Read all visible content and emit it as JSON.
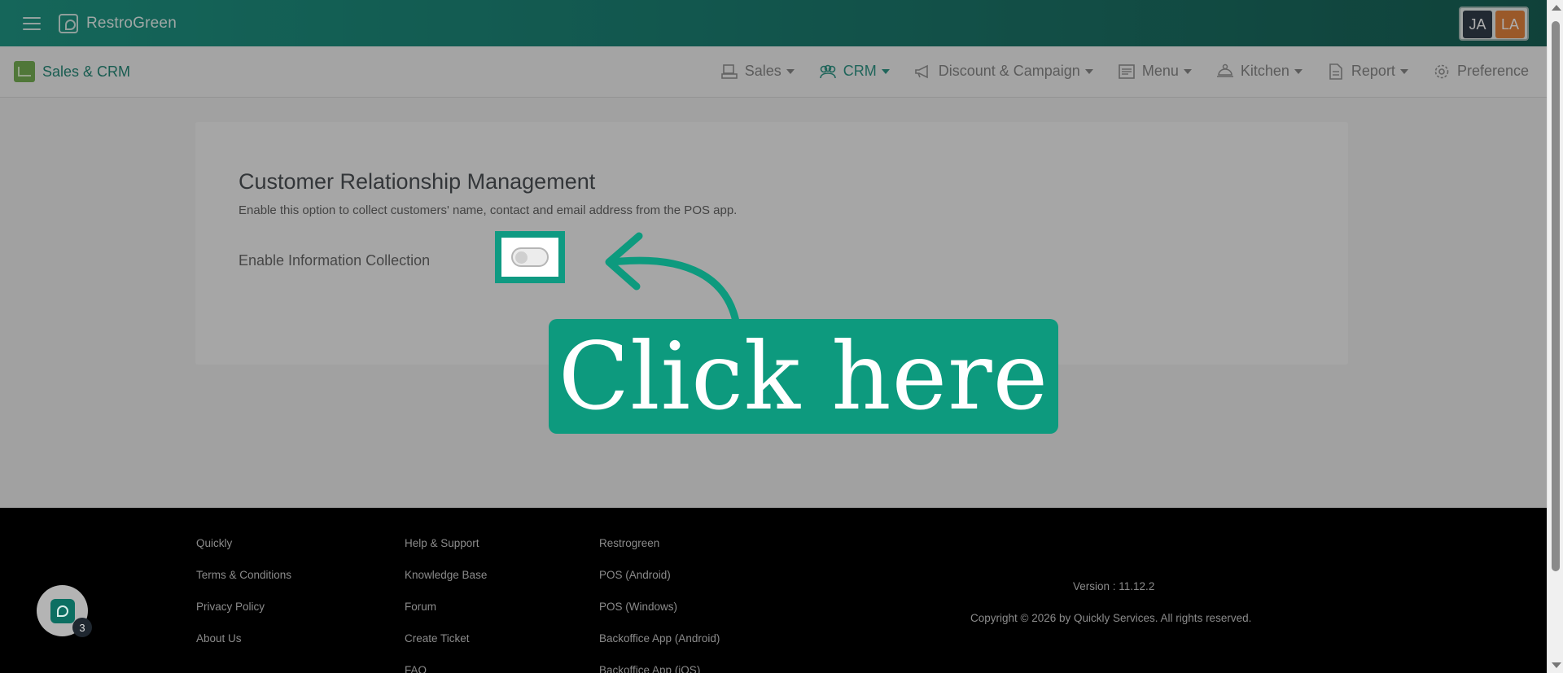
{
  "topbar": {
    "brand_name": "RestroGreen",
    "avatars": [
      "JA",
      "LA"
    ],
    "colors": {
      "brand_start": "#0a8d79",
      "brand_end": "#035246",
      "avatar_ja": "#1e2b39",
      "avatar_la": "#e0782a"
    }
  },
  "subnav": {
    "module_label": "Sales & CRM",
    "items": [
      {
        "label": "Sales",
        "icon": "pos-terminal-icon",
        "dropdown": true,
        "active": false
      },
      {
        "label": "CRM",
        "icon": "users-group-icon",
        "dropdown": true,
        "active": true
      },
      {
        "label": "Discount & Campaign",
        "icon": "megaphone-icon",
        "dropdown": true,
        "active": false
      },
      {
        "label": "Menu",
        "icon": "menu-list-icon",
        "dropdown": true,
        "active": false
      },
      {
        "label": "Kitchen",
        "icon": "chef-hat-icon",
        "dropdown": true,
        "active": false
      },
      {
        "label": "Report",
        "icon": "document-icon",
        "dropdown": true,
        "active": false
      },
      {
        "label": "Preference",
        "icon": "gear-icon",
        "dropdown": false,
        "active": false
      }
    ]
  },
  "crm": {
    "title": "Customer Relationship Management",
    "description": "Enable this option to collect customers' name, contact and email address from the POS app.",
    "toggle_label": "Enable Information Collection",
    "toggle_on": false
  },
  "callout": {
    "text": "Click here",
    "color": "#0d9a7e"
  },
  "footer": {
    "col1": [
      "Quickly",
      "Terms & Conditions",
      "Privacy Policy",
      "About Us"
    ],
    "col2": [
      "Help & Support",
      "Knowledge Base",
      "Forum",
      "Create Ticket",
      "FAQ"
    ],
    "col3": [
      "Restrogreen",
      "POS (Android)",
      "POS (Windows)",
      "Backoffice App (Android)",
      "Backoffice App (iOS)"
    ],
    "version": "Version : 11.12.2",
    "copyright": "Copyright © 2026 by Quickly Services. All rights reserved.",
    "chat_badge": "3"
  }
}
